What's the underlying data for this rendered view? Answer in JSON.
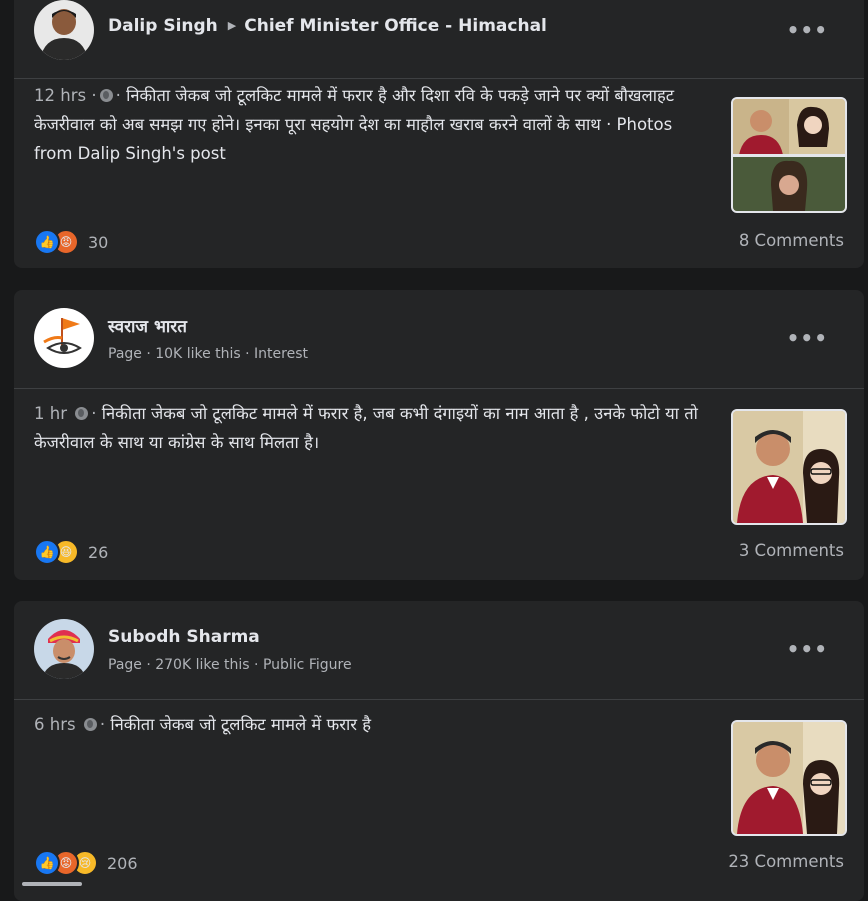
{
  "posts": [
    {
      "author": "Dalip Singh",
      "group": "Chief Minister Office - Himachal",
      "meta": "",
      "time": "12 hrs",
      "text": "निकीता जेकब जो टूलकिट मामले में फरार है और दिशा रवि के पकड़े जाने पर क्यों बौखलाहट केजरीवाल को अब समझ गए होने। इनका पूरा सहयोग देश का माहौल खराब करने वालों के साथ · Photos from Dalip Singh's post",
      "reactions": [
        "like-icon",
        "angry-icon"
      ],
      "reaction_count": "30",
      "comments": "8 Comments"
    },
    {
      "author": "स्वराज भारत",
      "group": "",
      "meta": "Page · 10K like this · Interest",
      "time": "1 hr",
      "text": "निकीता जेकब जो टूलकिट मामले में फरार है, जब कभी दंगाइयों का नाम आता है , उनके फोटो या तो केजरीवाल के साथ या कांग्रेस के साथ मिलता है।",
      "reactions": [
        "like-icon",
        "haha-icon"
      ],
      "reaction_count": "26",
      "comments": "3 Comments"
    },
    {
      "author": "Subodh Sharma",
      "group": "",
      "meta": "Page · 270K like this · Public Figure",
      "time": "6 hrs",
      "text": "निकीता जेकब जो टूलकिट मामले में फरार है",
      "reactions": [
        "like-icon",
        "angry-icon",
        "sad-icon"
      ],
      "reaction_count": "206",
      "comments": "23 Comments"
    }
  ],
  "colors": {
    "background": "#18191a",
    "card": "#242526",
    "text": "#e4e6eb",
    "secondary_text": "#b0b3b8",
    "like": "#1877f2",
    "angry": "#e8662a",
    "haha": "#f7b928"
  }
}
